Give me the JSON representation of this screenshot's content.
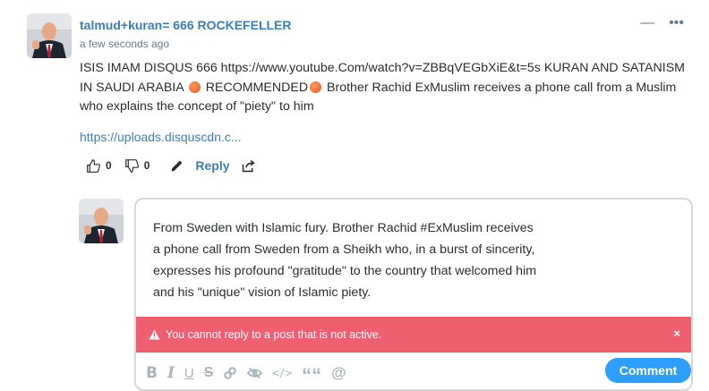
{
  "post": {
    "author": "talmud+kuran= 666 ROCKEFELLER",
    "timestamp": "a few seconds ago",
    "body_part1": "ISIS IMAM DISQUS 666 https://www.youtube.Com/watch?v=ZBBqVEGbXiE&t=5s KURAN AND SATANISM IN SAUDI ARABIA ",
    "body_part2": " RECOMMENDED",
    "body_part3": " Brother Rachid ExMuslim receives a phone call from a Muslim who explains the concept of \"piety\" to him",
    "link": "https://uploads.disquscdn.c...",
    "upvotes": "0",
    "downvotes": "0",
    "reply_label": "Reply",
    "menu_collapse": "—",
    "menu_more": "•••"
  },
  "reply": {
    "text_lines": [
      "From Sweden with Islamic fury. Brother Rachid #ExMuslim receives",
      "a phone call from Sweden from a Sheikh who, in a burst of sincerity,",
      "expresses his profound \"gratitude\" to the country that welcomed him",
      "and his \"unique\" vision of Islamic piety."
    ],
    "alert_text": "You cannot reply to a post that is not active.",
    "alert_close": "×",
    "comment_button": "Comment",
    "toolbar": {
      "bold": "B",
      "italic": "I",
      "underline": "U",
      "strike": "S",
      "code": "</>",
      "quote": "““",
      "mention": "@"
    }
  },
  "colors": {
    "link": "#3d7eb9",
    "alert": "#f05f70",
    "button": "#2e9fff"
  },
  "icons": [
    "thumbs-up-icon",
    "thumbs-down-icon",
    "edit-icon",
    "share-icon",
    "warning-icon",
    "link-icon",
    "spoiler-icon"
  ]
}
